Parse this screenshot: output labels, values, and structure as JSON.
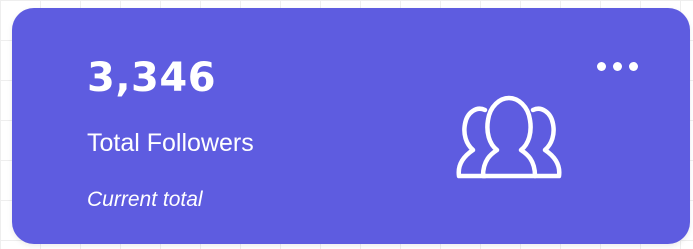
{
  "card": {
    "count": "3,346",
    "label": "Total Followers",
    "subtitle": "Current total",
    "menu_icon": "more-horizontal-icon",
    "main_icon": "users-group-icon",
    "background_color": "#5e5ce0",
    "text_color": "#ffffff"
  }
}
